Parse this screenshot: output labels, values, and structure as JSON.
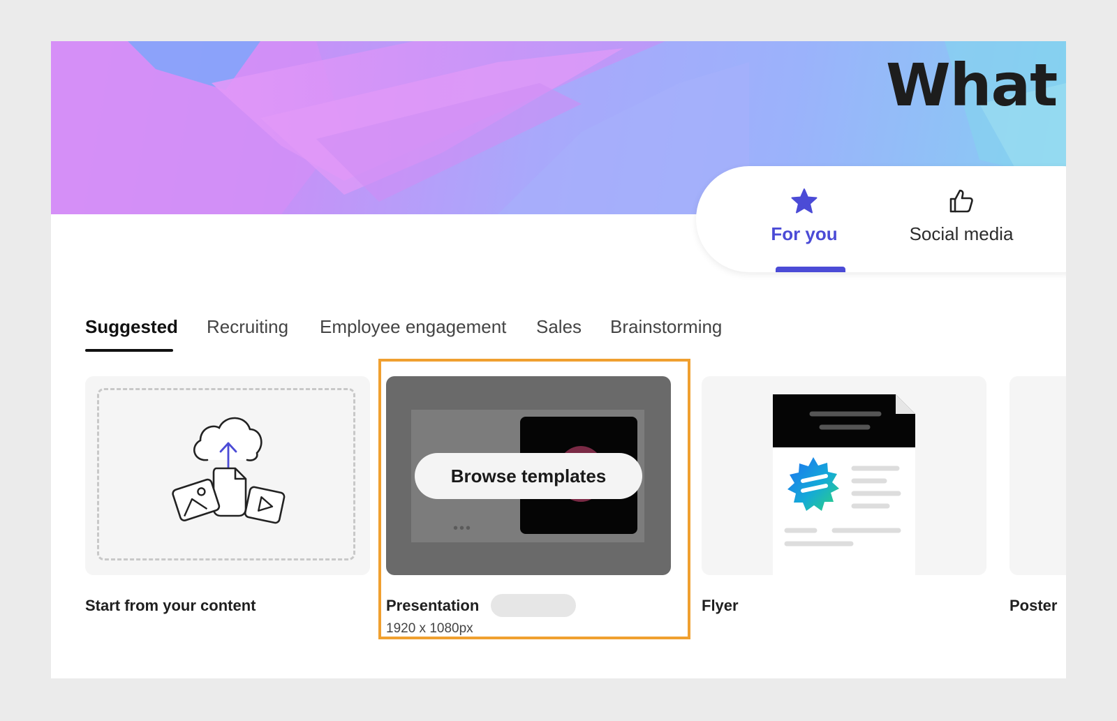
{
  "hero": {
    "title": "What c"
  },
  "categories": {
    "items": [
      {
        "label": "For you",
        "icon": "star-icon",
        "active": true
      },
      {
        "label": "Social media",
        "icon": "thumbs-up-icon",
        "active": false
      }
    ]
  },
  "tabs": {
    "items": [
      "Suggested",
      "Recruiting",
      "Employee engagement",
      "Sales",
      "Brainstorming"
    ],
    "active": "Suggested"
  },
  "cards": [
    {
      "title": "Start from your content",
      "icon": "cloud-upload-icon"
    },
    {
      "title": "Presentation",
      "subtitle": "1920 x 1080px",
      "hover_button": "Browse templates",
      "highlighted": true
    },
    {
      "title": "Flyer"
    },
    {
      "title": "Poster"
    }
  ],
  "colors": {
    "accent": "#4b4bd6",
    "highlight": "#f0a030",
    "text": "#1f1f1f"
  }
}
